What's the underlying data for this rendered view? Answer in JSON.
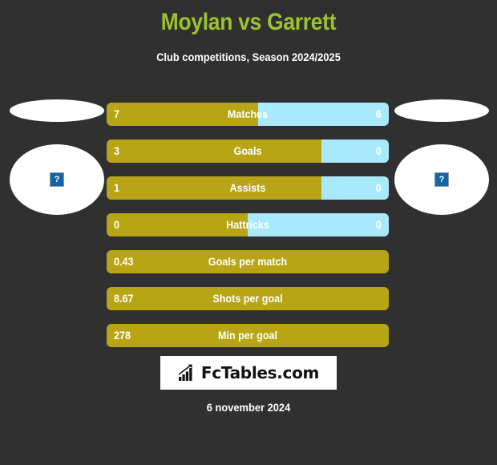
{
  "header": {
    "title": "Moylan vs Garrett",
    "subtitle": "Club competitions, Season 2024/2025",
    "title_color": "#9ac32e",
    "subtitle_color": "#ffffff"
  },
  "colors": {
    "background": "#303030",
    "home_bar": "#b8a516",
    "away_bar": "#a9e9fb",
    "panel": "#ffffff"
  },
  "players": {
    "home": {
      "name_placeholder": "",
      "photo_icon": "broken-image-icon"
    },
    "away": {
      "name_placeholder": "",
      "photo_icon": "broken-image-icon"
    }
  },
  "stats": [
    {
      "label": "Matches",
      "home": "7",
      "away": "6",
      "home_pct": 53.8,
      "away_pct": 46.2,
      "split": true
    },
    {
      "label": "Goals",
      "home": "3",
      "away": "0",
      "home_pct": 76.0,
      "away_pct": 24.0,
      "split": true
    },
    {
      "label": "Assists",
      "home": "1",
      "away": "0",
      "home_pct": 76.0,
      "away_pct": 24.0,
      "split": true
    },
    {
      "label": "Hattricks",
      "home": "0",
      "away": "0",
      "home_pct": 50.0,
      "away_pct": 50.0,
      "split": true
    },
    {
      "label": "Goals per match",
      "home": "0.43",
      "away": "",
      "home_pct": 100,
      "away_pct": 0,
      "split": false
    },
    {
      "label": "Shots per goal",
      "home": "8.67",
      "away": "",
      "home_pct": 100,
      "away_pct": 0,
      "split": false
    },
    {
      "label": "Min per goal",
      "home": "278",
      "away": "",
      "home_pct": 100,
      "away_pct": 0,
      "split": false
    }
  ],
  "footer": {
    "logo_text": "FcTables.com",
    "logo_icon": "bar-chart-growth-icon",
    "date": "6 november 2024"
  },
  "chart_data": {
    "type": "bar",
    "title": "Moylan vs Garrett",
    "subtitle": "Club competitions, Season 2024/2025",
    "categories": [
      "Matches",
      "Goals",
      "Assists",
      "Hattricks",
      "Goals per match",
      "Shots per goal",
      "Min per goal"
    ],
    "series": [
      {
        "name": "Moylan",
        "color": "#b8a516",
        "values": [
          7,
          3,
          1,
          0,
          0.43,
          8.67,
          278
        ]
      },
      {
        "name": "Garrett",
        "color": "#a9e9fb",
        "values": [
          6,
          0,
          0,
          0,
          null,
          null,
          null
        ]
      }
    ],
    "orientation": "horizontal-paired",
    "legend": "none",
    "grid": false
  }
}
